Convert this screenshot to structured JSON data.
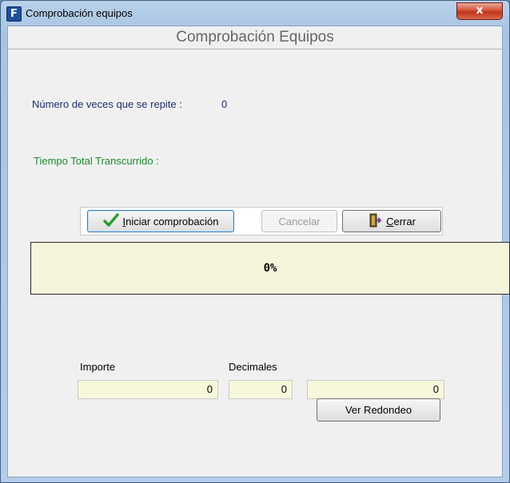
{
  "window": {
    "title": "Comprobación equipos",
    "close_label": "x"
  },
  "dialog": {
    "header": "Comprobación Equipos",
    "repeat_label": "Número de veces que se repite :",
    "repeat_value": "0",
    "time_label": "Tiempo Total Transcurrido :"
  },
  "buttons": {
    "start": {
      "mnemonic": "I",
      "rest": "niciar comprobación",
      "icon": "checkmark-icon"
    },
    "cancel": {
      "label": "Cancelar"
    },
    "close": {
      "mnemonic": "C",
      "rest": "errar",
      "icon": "door-exit-icon"
    }
  },
  "progress": {
    "text": "0%",
    "value": 0
  },
  "fields": {
    "importe_label": "Importe",
    "importe_value": "0",
    "decimales_label": "Decimales",
    "decimales_value": "0",
    "resultado_value": "0"
  },
  "redondeo_button": "Ver Redondeo",
  "colors": {
    "accent_green": "#1a8a2a",
    "label_blue": "#1f2e6b",
    "field_background": "#f7f7dc"
  }
}
